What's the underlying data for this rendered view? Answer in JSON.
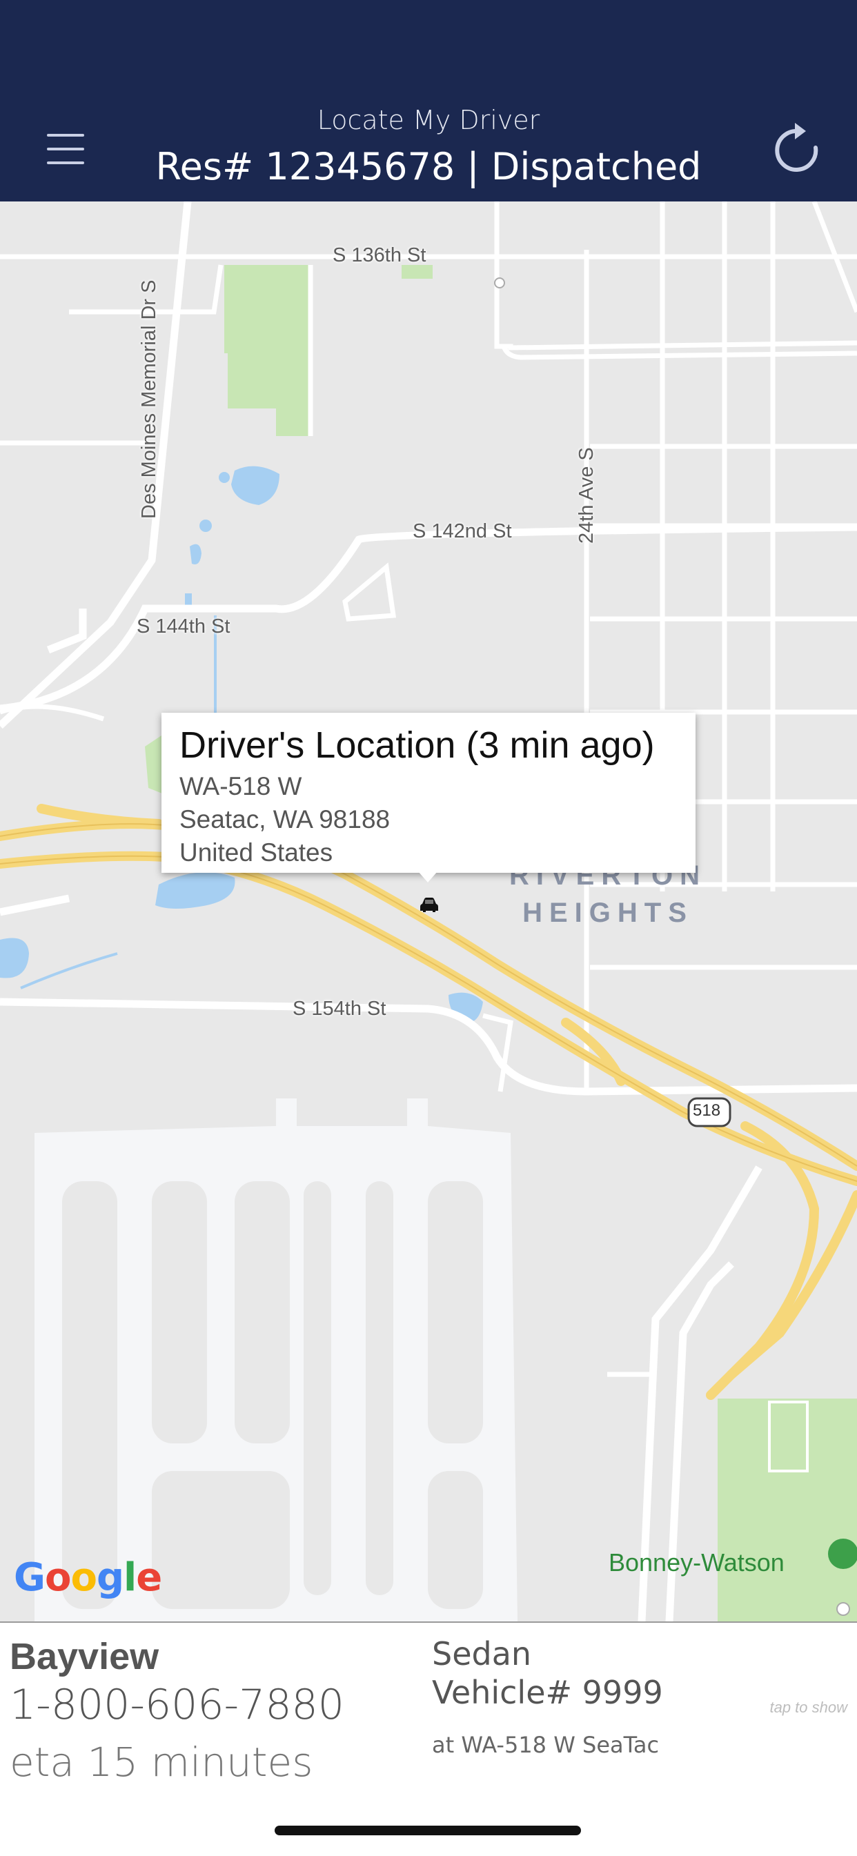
{
  "header": {
    "title": "Locate My Driver",
    "subtitle": "Res# 12345678 | Dispatched",
    "menu_icon": "hamburger-menu-icon",
    "refresh_icon": "refresh-icon"
  },
  "map": {
    "roads": {
      "s136": "S 136th St",
      "des_moines": "Des Moines Memorial Dr S",
      "s142": "S 142nd St",
      "ave24": "24th Ave S",
      "s144": "S 144th St",
      "s154": "S 154th St",
      "route_518": "518"
    },
    "area": {
      "line1": "RIVERTON",
      "line2": "HEIGHTS"
    },
    "place": "Bonney-Watson",
    "google_logo": "Google",
    "popup": {
      "title": "Driver's Location (3 min ago)",
      "line1": "WA-518 W",
      "line2": "Seatac, WA  98188",
      "line3": "United States"
    }
  },
  "driver": {
    "company": "Bayview",
    "phone": "1-800-606-7880",
    "eta": "eta 15 minutes",
    "vehicle_type": "Sedan",
    "vehicle_number": "Vehicle# 9999",
    "location": "at WA-518 W SeaTac",
    "tap_hint": "tap to show"
  },
  "colors": {
    "header_bg": "#1b2850",
    "map_bg": "#e8e8e8",
    "highway": "#f6d77a",
    "water": "#a6cff2",
    "park": "#c8e6b4",
    "airport": "#f5f6f8"
  }
}
